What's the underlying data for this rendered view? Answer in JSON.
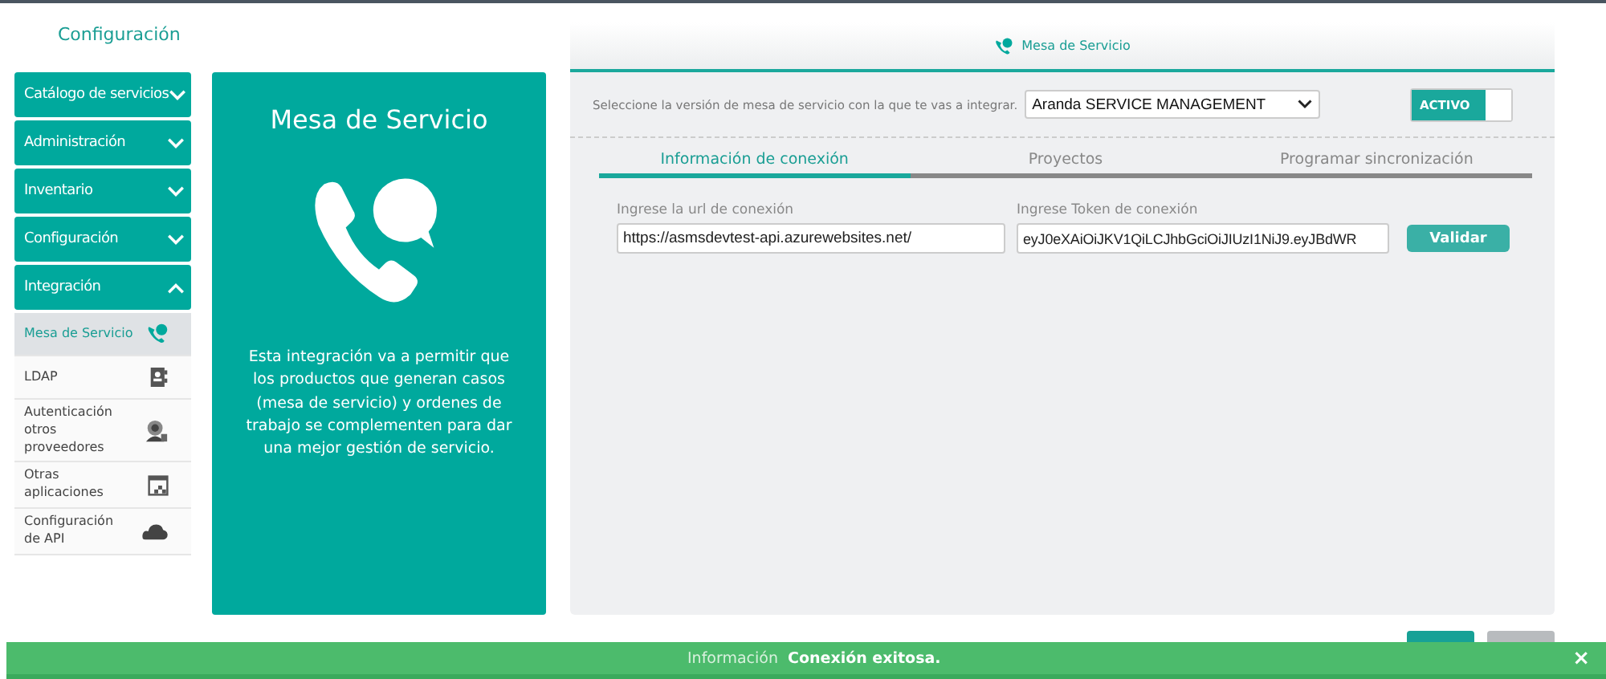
{
  "page_title": "Configuración",
  "sidebar": {
    "items": [
      {
        "label": "Catálogo de servicios",
        "expanded": false
      },
      {
        "label": "Administración",
        "expanded": false
      },
      {
        "label": "Inventario",
        "expanded": false
      },
      {
        "label": "Configuración",
        "expanded": false
      },
      {
        "label": "Integración",
        "expanded": true,
        "children": [
          {
            "label": "Mesa de Servicio",
            "selected": true,
            "kind": "phone"
          },
          {
            "label": "LDAP",
            "selected": false,
            "kind": "book"
          },
          {
            "label": "Autenticación otros proveedores",
            "selected": false,
            "kind": "user"
          },
          {
            "label": "Otras aplicaciones",
            "selected": false,
            "kind": "apps"
          },
          {
            "label": "Configuración de API",
            "selected": false,
            "kind": "api"
          }
        ]
      }
    ]
  },
  "info_card": {
    "title": "Mesa de Servicio",
    "description": "Esta integración va a permitir que los productos que generan casos (mesa de servicio) y ordenes de trabajo se complementen para dar una mejor gestión de servicio."
  },
  "panel": {
    "title": "Mesa de Servicio",
    "version_label": "Seleccione la versión de mesa de servicio con la que te vas a integrar.",
    "version_value": "Aranda SERVICE MANAGEMENT",
    "toggle": {
      "label": "ACTIVO",
      "on": true
    },
    "tabs": [
      {
        "label": "Información de conexión",
        "selected": true
      },
      {
        "label": "Proyectos",
        "selected": false
      },
      {
        "label": "Programar sincronización",
        "selected": false
      }
    ],
    "url_field": {
      "label": "Ingrese la url de conexión",
      "value": "https://asmsdevtest-api.azurewebsites.net/"
    },
    "token_field": {
      "label": "Ingrese Token de conexión",
      "value": "eyJ0eXAiOiJKV1QiLCJhbGciOiJIUzI1NiJ9.eyJBdWR"
    },
    "validate_button": "Validar"
  },
  "footer_buttons": [
    {
      "kind": "primary"
    },
    {
      "kind": "disabled"
    }
  ],
  "toast": {
    "heading": "Información",
    "message": "Conexión exitosa.",
    "close": "×"
  }
}
